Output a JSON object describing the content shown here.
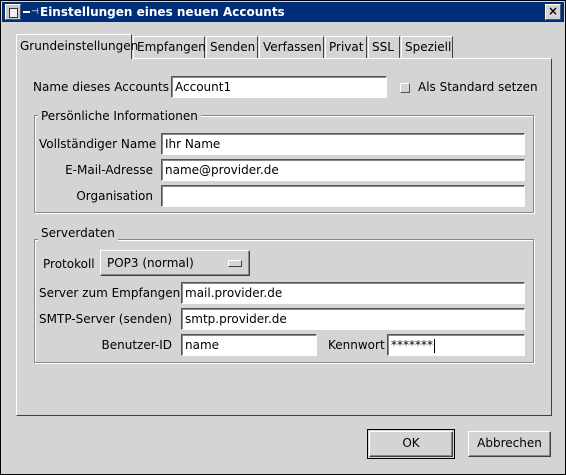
{
  "window": {
    "title": "Einstellungen eines neuen Accounts",
    "close_label": "×"
  },
  "tabs": [
    {
      "label": "Grundeinstellungen",
      "active": true
    },
    {
      "label": "Empfangen"
    },
    {
      "label": "Senden"
    },
    {
      "label": "Verfassen"
    },
    {
      "label": "Privat"
    },
    {
      "label": "SSL"
    },
    {
      "label": "Speziell"
    }
  ],
  "account": {
    "name_label": "Name dieses Accounts",
    "name_value": "Account1",
    "default_label": "Als Standard setzen",
    "default_checked": false
  },
  "personal": {
    "title": "Persönliche Informationen",
    "fullname_label": "Vollständiger Name",
    "fullname_value": "Ihr Name",
    "email_label": "E-Mail-Adresse",
    "email_value": "name@provider.de",
    "org_label": "Organisation",
    "org_value": ""
  },
  "server": {
    "title": "Serverdaten",
    "protocol_label": "Protokoll",
    "protocol_value": "POP3 (normal)",
    "incoming_label": "Server zum Empfangen",
    "incoming_value": "mail.provider.de",
    "smtp_label": "SMTP-Server (senden)",
    "smtp_value": "smtp.provider.de",
    "userid_label": "Benutzer-ID",
    "userid_value": "name",
    "password_label": "Kennwort",
    "password_value": "*******"
  },
  "buttons": {
    "ok": "OK",
    "cancel": "Abbrechen"
  }
}
